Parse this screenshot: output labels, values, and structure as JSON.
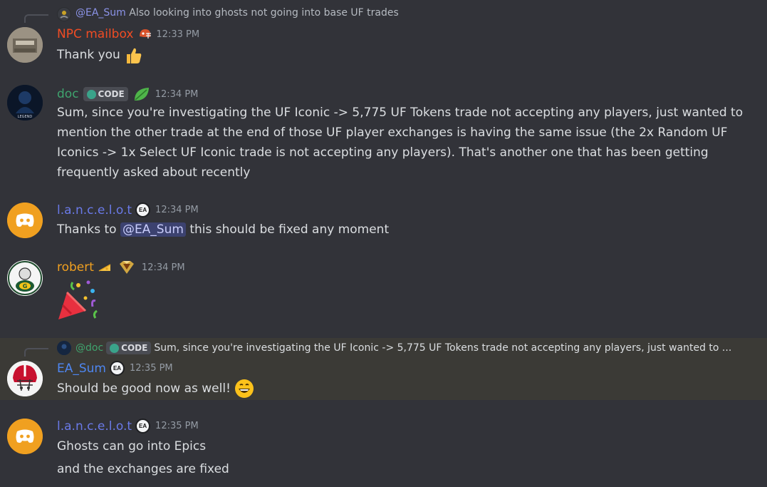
{
  "messages": [
    {
      "reply": {
        "mention": "@EA_Sum",
        "text": "Also looking into ghosts not going into base UF trades"
      },
      "author": "NPC mailbox",
      "author_color": "#f04c24",
      "timestamp": "12:33 PM",
      "lines": [
        "Thank you"
      ],
      "avatar_text": "NPC MAILBOX"
    },
    {
      "author": "doc",
      "author_color": "#3fa46e",
      "tag": "CODE",
      "timestamp": "12:34 PM",
      "avatar_text": "LEGEND",
      "lines": [
        "Sum, since you're investigating the UF Iconic -> 5,775 UF Tokens trade not accepting any players, just wanted to",
        "mention the other trade at the end of those UF player exchanges is having the same issue (the 2x Random UF",
        "Iconics -> 1x Select UF Iconic trade is not accepting any players). That's another one that has been getting",
        "frequently asked about recently"
      ]
    },
    {
      "author": "l.a.n.c.e.l.o.t",
      "author_color": "#6a7ae8",
      "timestamp": "12:34 PM",
      "badge": "EA",
      "line_prefix": "Thanks to",
      "line_mention": "@EA_Sum",
      "line_suffix": "this should be fixed any moment"
    },
    {
      "author": "robert",
      "author_color": "#f0a020",
      "timestamp": "12:34 PM"
    },
    {
      "reply": {
        "mention": "@doc",
        "tag": "CODE",
        "text": "Sum, since you're investigating the UF Iconic -> 5,775 UF Tokens trade not accepting any players, just wanted to ..."
      },
      "author": "EA_Sum",
      "author_color": "#4e86f0",
      "badge": "EA",
      "timestamp": "12:35 PM",
      "lines": [
        "Should be good now as well!"
      ]
    },
    {
      "author": "l.a.n.c.e.l.o.t",
      "author_color": "#6a7ae8",
      "badge": "EA",
      "timestamp": "12:35 PM",
      "lines": [
        "Ghosts can go into Epics",
        "and the exchanges are fixed"
      ]
    }
  ],
  "colors": {
    "background": "#323339",
    "highlight": "#3b3a36",
    "discord_orange": "#f0a020"
  }
}
